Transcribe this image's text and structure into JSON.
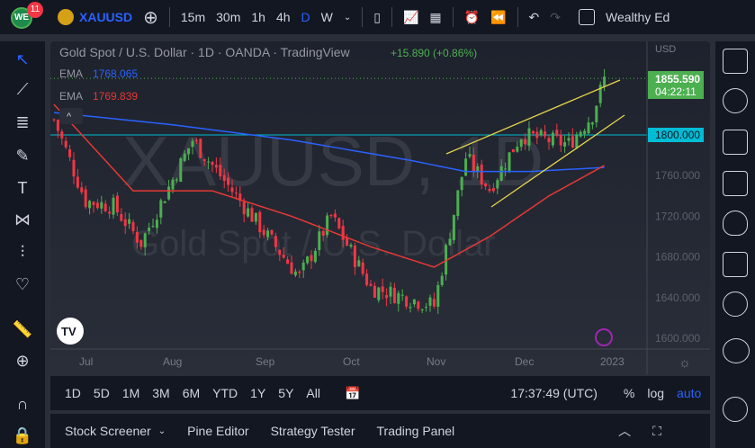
{
  "toolbar": {
    "badge": "11",
    "logo": "WE",
    "symbol": "XAUUSD",
    "intervals": [
      "15m",
      "30m",
      "1h",
      "4h",
      "D",
      "W"
    ],
    "active_interval": "D",
    "layout_name": "Wealthy Ed"
  },
  "legend": {
    "title": "Gold Spot / U.S. Dollar · 1D · OANDA · TradingView",
    "change": "+15.890 (+0.86%)",
    "ema1_label": "EMA",
    "ema1_value": "1768.065",
    "ema2_label": "EMA",
    "ema2_value": "1769.839"
  },
  "watermark": {
    "symbol": "XAUUSD, 1D",
    "name": "Gold Spot / U.S. Dollar"
  },
  "price_axis": {
    "currency": "USD",
    "last_price": "1855.590",
    "countdown": "04:22:11",
    "line_label": "1800.000",
    "ticks": [
      "1760.000",
      "1720.000",
      "1680.000",
      "1640.000",
      "1600.000"
    ]
  },
  "time_axis": {
    "ticks": [
      "Jul",
      "Aug",
      "Sep",
      "Oct",
      "Nov",
      "Dec",
      "2023"
    ]
  },
  "ranges": [
    "1D",
    "5D",
    "1M",
    "3M",
    "6M",
    "YTD",
    "1Y",
    "5Y",
    "All"
  ],
  "bottom_bar": {
    "clock": "17:37:49 (UTC)",
    "percent": "%",
    "log": "log",
    "auto": "auto"
  },
  "panels": [
    "Stock Screener",
    "Pine Editor",
    "Strategy Tester",
    "Trading Panel"
  ],
  "colors": {
    "up": "#26a69a",
    "upbar": "#4caf50",
    "down": "#f23645",
    "ema_blue": "#2962ff",
    "ema_red": "#e53935",
    "hline": "#00bcd4",
    "trend": "#e5d64a"
  },
  "chart_data": {
    "type": "candlestick",
    "ylim": [
      1590,
      1875
    ],
    "bars": 140,
    "close_anchors": [
      [
        0,
        1815
      ],
      [
        8,
        1735
      ],
      [
        15,
        1730
      ],
      [
        22,
        1694
      ],
      [
        35,
        1795
      ],
      [
        50,
        1720
      ],
      [
        62,
        1660
      ],
      [
        70,
        1720
      ],
      [
        80,
        1650
      ],
      [
        96,
        1632
      ],
      [
        104,
        1778
      ],
      [
        110,
        1747
      ],
      [
        118,
        1800
      ],
      [
        130,
        1791
      ],
      [
        136,
        1820
      ],
      [
        139,
        1855
      ]
    ],
    "ema_blue_anchors": [
      [
        0,
        1822
      ],
      [
        30,
        1810
      ],
      [
        60,
        1795
      ],
      [
        90,
        1775
      ],
      [
        104,
        1764
      ],
      [
        120,
        1764
      ],
      [
        139,
        1768
      ]
    ],
    "ema_red_anchors": [
      [
        0,
        1830
      ],
      [
        20,
        1745
      ],
      [
        40,
        1745
      ],
      [
        60,
        1720
      ],
      [
        80,
        1690
      ],
      [
        96,
        1670
      ],
      [
        110,
        1700
      ],
      [
        125,
        1740
      ],
      [
        139,
        1770
      ]
    ],
    "hline": 1800
  }
}
